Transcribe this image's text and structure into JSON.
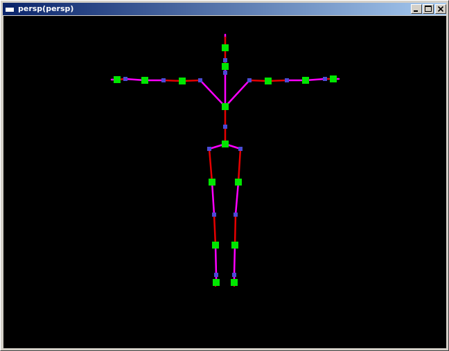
{
  "window": {
    "title": "persp(persp)",
    "buttons": {
      "minimize": "minimize",
      "maximize": "maximize",
      "close": "close"
    }
  },
  "icons": {
    "app": "window-app-icon",
    "minimize": "minimize-icon",
    "maximize": "maximize-icon",
    "close": "close-icon"
  },
  "colors": {
    "background": "#000000",
    "joint": "#00e600",
    "marker": "#4b4bd6",
    "bone_primary": "#ff00ff",
    "bone_secondary": "#e60000",
    "titlebar_start": "#0a246a",
    "titlebar_end": "#a6caf0"
  }
}
